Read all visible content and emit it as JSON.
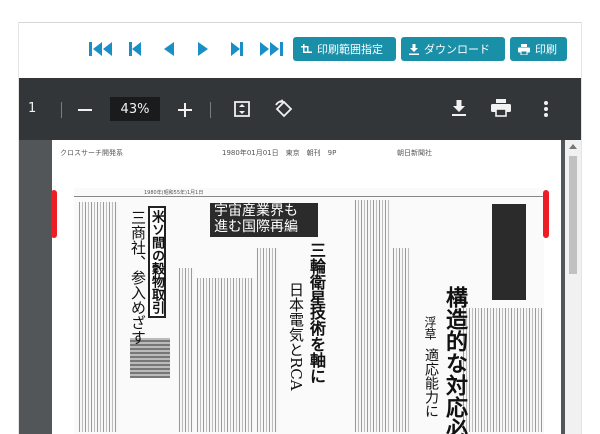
{
  "toolbar": {
    "nav_buttons": [
      "first-page",
      "prev-section",
      "prev-page",
      "next-page",
      "next-section",
      "last-page"
    ],
    "range_label": "印刷範囲指定",
    "download_label": "ダウンロード",
    "print_label": "印刷",
    "accent_color": "#1a8fa8"
  },
  "viewer": {
    "page_number": "1",
    "zoom": "43%",
    "icons": [
      "minus-icon",
      "plus-icon",
      "fit-page-icon",
      "rotate-icon",
      "download-icon",
      "print-icon",
      "more-icon"
    ]
  },
  "document": {
    "source": "クロスサーチ開発系",
    "date": "1980年01月01日　東京　朝刊　9P",
    "publisher": "朝日新聞社",
    "paper_date_line": "1980年(昭和55年)1月1日",
    "headlines": {
      "h1": "宇宙産業界も",
      "h2": "進む国際再編",
      "h3": "米ソ間の穀物取引",
      "h4": "三商社、参入めざす",
      "h5": "三輪衛星",
      "h6": "技術を軸に",
      "h7": "日本電気とRCA",
      "h8": "構造的な対応必",
      "h9": "浮草",
      "h10": "適応能力に"
    }
  }
}
